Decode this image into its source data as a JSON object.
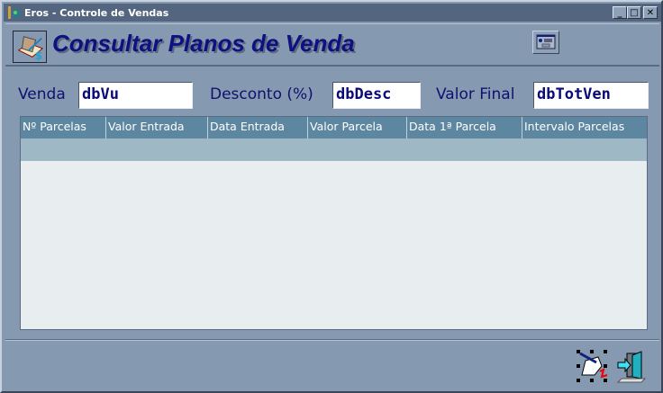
{
  "window": {
    "title": "Eros - Controle de Vendas",
    "minimize": "_",
    "maximize": "□",
    "close": "✕"
  },
  "header": {
    "title": "Consultar Planos de Venda"
  },
  "fields": {
    "venda": {
      "label": "Venda",
      "value": "dbVu"
    },
    "desconto": {
      "label": "Desconto (%)",
      "value": "dbDesc"
    },
    "valor_final": {
      "label": "Valor Final",
      "value": "dbTotVen"
    }
  },
  "grid": {
    "columns": [
      "Nº Parcelas",
      "Valor Entrada",
      "Data Entrada",
      "Valor Parcela",
      "Data 1ª Parcela",
      "Intervalo Parcelas"
    ]
  },
  "colors": {
    "title_text": "#101080",
    "grid_header": "#5d86a0"
  }
}
